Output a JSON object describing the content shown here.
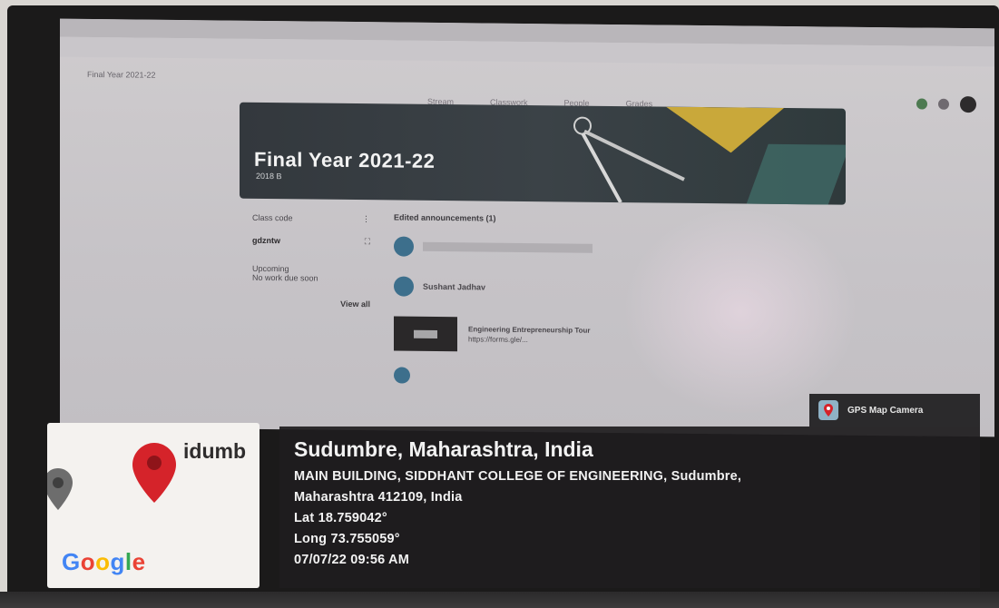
{
  "screen": {
    "classroom_title": "Final Year 2021-22",
    "nav_tabs": [
      "Stream",
      "Classwork",
      "People",
      "Grades"
    ],
    "banner": {
      "title": "Final Year 2021-22",
      "subtitle": "2018 B"
    },
    "left_column": {
      "class_code_label": "Class code",
      "class_code_value": "gdzntw",
      "upcoming_label": "Upcoming",
      "upcoming_text": "No work due soon",
      "view_all": "View all"
    },
    "stream": {
      "header": "Edited announcements (1)",
      "announcement_text": "Sushant Jadhav",
      "attachment_title": "Engineering Entrepreneurship Tour",
      "attachment_url": "https://forms.gle/..."
    }
  },
  "overlay": {
    "gps_badge_label": "GPS Map Camera",
    "map_place": "idumb",
    "map_brand": "Google",
    "location_title": "Sudumbre, Maharashtra, India",
    "address_line1": "MAIN BUILDING, SIDDHANT COLLEGE OF ENGINEERING, Sudumbre,",
    "address_line2": "Maharashtra 412109, India",
    "lat": "Lat 18.759042°",
    "long": "Long 73.755059°",
    "datetime": "07/07/22 09:56 AM"
  },
  "colors": {
    "pin_red": "#d5232a",
    "panel_bg": "#1e1c1e",
    "banner_bg": "#353b40"
  }
}
